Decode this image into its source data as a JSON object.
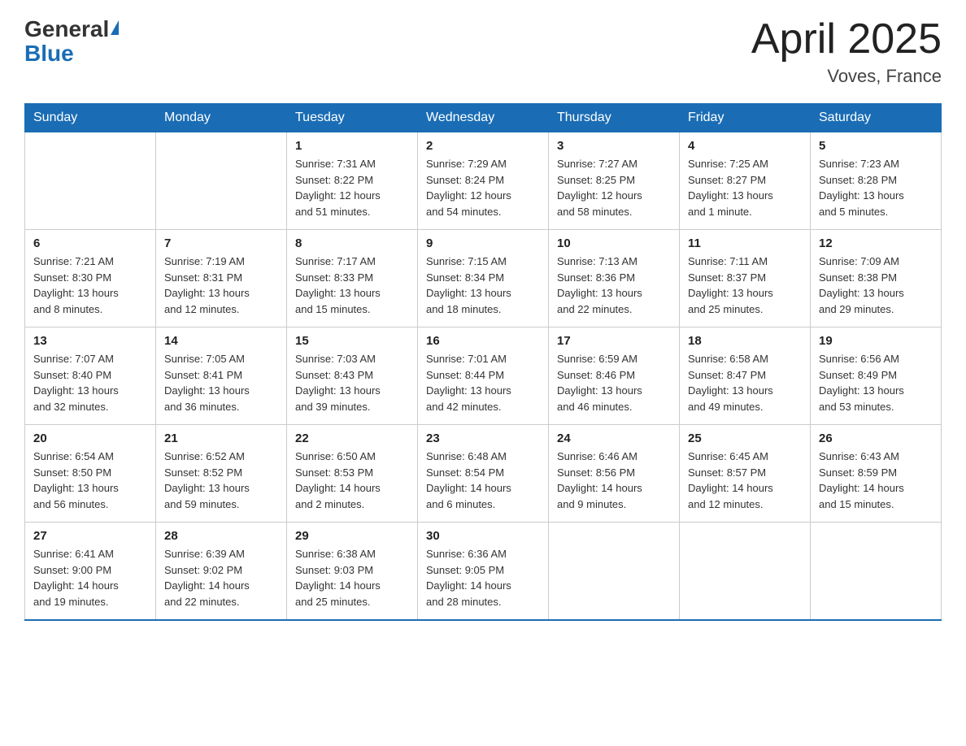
{
  "header": {
    "logo_general": "General",
    "logo_blue": "Blue",
    "title": "April 2025",
    "subtitle": "Voves, France"
  },
  "days_of_week": [
    "Sunday",
    "Monday",
    "Tuesday",
    "Wednesday",
    "Thursday",
    "Friday",
    "Saturday"
  ],
  "weeks": [
    [
      {
        "day": "",
        "info": ""
      },
      {
        "day": "",
        "info": ""
      },
      {
        "day": "1",
        "info": "Sunrise: 7:31 AM\nSunset: 8:22 PM\nDaylight: 12 hours\nand 51 minutes."
      },
      {
        "day": "2",
        "info": "Sunrise: 7:29 AM\nSunset: 8:24 PM\nDaylight: 12 hours\nand 54 minutes."
      },
      {
        "day": "3",
        "info": "Sunrise: 7:27 AM\nSunset: 8:25 PM\nDaylight: 12 hours\nand 58 minutes."
      },
      {
        "day": "4",
        "info": "Sunrise: 7:25 AM\nSunset: 8:27 PM\nDaylight: 13 hours\nand 1 minute."
      },
      {
        "day": "5",
        "info": "Sunrise: 7:23 AM\nSunset: 8:28 PM\nDaylight: 13 hours\nand 5 minutes."
      }
    ],
    [
      {
        "day": "6",
        "info": "Sunrise: 7:21 AM\nSunset: 8:30 PM\nDaylight: 13 hours\nand 8 minutes."
      },
      {
        "day": "7",
        "info": "Sunrise: 7:19 AM\nSunset: 8:31 PM\nDaylight: 13 hours\nand 12 minutes."
      },
      {
        "day": "8",
        "info": "Sunrise: 7:17 AM\nSunset: 8:33 PM\nDaylight: 13 hours\nand 15 minutes."
      },
      {
        "day": "9",
        "info": "Sunrise: 7:15 AM\nSunset: 8:34 PM\nDaylight: 13 hours\nand 18 minutes."
      },
      {
        "day": "10",
        "info": "Sunrise: 7:13 AM\nSunset: 8:36 PM\nDaylight: 13 hours\nand 22 minutes."
      },
      {
        "day": "11",
        "info": "Sunrise: 7:11 AM\nSunset: 8:37 PM\nDaylight: 13 hours\nand 25 minutes."
      },
      {
        "day": "12",
        "info": "Sunrise: 7:09 AM\nSunset: 8:38 PM\nDaylight: 13 hours\nand 29 minutes."
      }
    ],
    [
      {
        "day": "13",
        "info": "Sunrise: 7:07 AM\nSunset: 8:40 PM\nDaylight: 13 hours\nand 32 minutes."
      },
      {
        "day": "14",
        "info": "Sunrise: 7:05 AM\nSunset: 8:41 PM\nDaylight: 13 hours\nand 36 minutes."
      },
      {
        "day": "15",
        "info": "Sunrise: 7:03 AM\nSunset: 8:43 PM\nDaylight: 13 hours\nand 39 minutes."
      },
      {
        "day": "16",
        "info": "Sunrise: 7:01 AM\nSunset: 8:44 PM\nDaylight: 13 hours\nand 42 minutes."
      },
      {
        "day": "17",
        "info": "Sunrise: 6:59 AM\nSunset: 8:46 PM\nDaylight: 13 hours\nand 46 minutes."
      },
      {
        "day": "18",
        "info": "Sunrise: 6:58 AM\nSunset: 8:47 PM\nDaylight: 13 hours\nand 49 minutes."
      },
      {
        "day": "19",
        "info": "Sunrise: 6:56 AM\nSunset: 8:49 PM\nDaylight: 13 hours\nand 53 minutes."
      }
    ],
    [
      {
        "day": "20",
        "info": "Sunrise: 6:54 AM\nSunset: 8:50 PM\nDaylight: 13 hours\nand 56 minutes."
      },
      {
        "day": "21",
        "info": "Sunrise: 6:52 AM\nSunset: 8:52 PM\nDaylight: 13 hours\nand 59 minutes."
      },
      {
        "day": "22",
        "info": "Sunrise: 6:50 AM\nSunset: 8:53 PM\nDaylight: 14 hours\nand 2 minutes."
      },
      {
        "day": "23",
        "info": "Sunrise: 6:48 AM\nSunset: 8:54 PM\nDaylight: 14 hours\nand 6 minutes."
      },
      {
        "day": "24",
        "info": "Sunrise: 6:46 AM\nSunset: 8:56 PM\nDaylight: 14 hours\nand 9 minutes."
      },
      {
        "day": "25",
        "info": "Sunrise: 6:45 AM\nSunset: 8:57 PM\nDaylight: 14 hours\nand 12 minutes."
      },
      {
        "day": "26",
        "info": "Sunrise: 6:43 AM\nSunset: 8:59 PM\nDaylight: 14 hours\nand 15 minutes."
      }
    ],
    [
      {
        "day": "27",
        "info": "Sunrise: 6:41 AM\nSunset: 9:00 PM\nDaylight: 14 hours\nand 19 minutes."
      },
      {
        "day": "28",
        "info": "Sunrise: 6:39 AM\nSunset: 9:02 PM\nDaylight: 14 hours\nand 22 minutes."
      },
      {
        "day": "29",
        "info": "Sunrise: 6:38 AM\nSunset: 9:03 PM\nDaylight: 14 hours\nand 25 minutes."
      },
      {
        "day": "30",
        "info": "Sunrise: 6:36 AM\nSunset: 9:05 PM\nDaylight: 14 hours\nand 28 minutes."
      },
      {
        "day": "",
        "info": ""
      },
      {
        "day": "",
        "info": ""
      },
      {
        "day": "",
        "info": ""
      }
    ]
  ]
}
